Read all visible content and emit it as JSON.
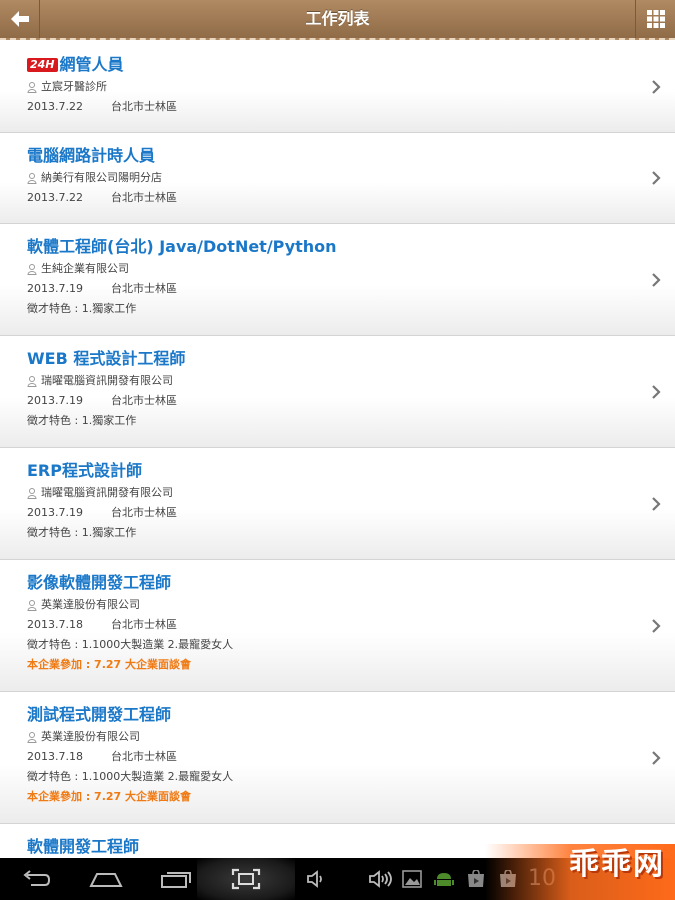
{
  "header": {
    "title": "工作列表"
  },
  "jobs": [
    {
      "badge": "24H",
      "title": "網管人員",
      "company": "立宸牙醫診所",
      "date": "2013.7.22",
      "location": "台北市士林區",
      "feature": "",
      "event": ""
    },
    {
      "badge": "",
      "title": "電腦網路計時人員",
      "company": "納美行有限公司陽明分店",
      "date": "2013.7.22",
      "location": "台北市士林區",
      "feature": "",
      "event": ""
    },
    {
      "badge": "",
      "title": "軟體工程師(台北) Java/DotNet/Python",
      "company": "生純企業有限公司",
      "date": "2013.7.19",
      "location": "台北市士林區",
      "feature": "徵才特色 : 1.獨家工作",
      "event": ""
    },
    {
      "badge": "",
      "title": "WEB 程式設計工程師",
      "company": "瑞曜電腦資訊開發有限公司",
      "date": "2013.7.19",
      "location": "台北市士林區",
      "feature": "徵才特色 : 1.獨家工作",
      "event": ""
    },
    {
      "badge": "",
      "title": "ERP程式設計師",
      "company": "瑞曜電腦資訊開發有限公司",
      "date": "2013.7.19",
      "location": "台北市士林區",
      "feature": "徵才特色 : 1.獨家工作",
      "event": ""
    },
    {
      "badge": "",
      "title": "影像軟體開發工程師",
      "company": "英業達股份有限公司",
      "date": "2013.7.18",
      "location": "台北市士林區",
      "feature": "徵才特色 : 1.1000大製造業 2.最寵愛女人",
      "event": "本企業參加 : 7.27 大企業面談會"
    },
    {
      "badge": "",
      "title": "測試程式開發工程師",
      "company": "英業達股份有限公司",
      "date": "2013.7.18",
      "location": "台北市士林區",
      "feature": "徵才特色 : 1.1000大製造業 2.最寵愛女人",
      "event": "本企業參加 : 7.27 大企業面談會"
    },
    {
      "badge": "",
      "title": "軟體開發工程師",
      "company": "",
      "date": "",
      "location": "",
      "feature": "",
      "event": ""
    }
  ],
  "navbar": {
    "clock": "10",
    "brand": "乖乖网"
  },
  "icons": {
    "back": "arrow-left-icon",
    "grid": "grid-menu-icon",
    "person": "person-icon",
    "chevron": "chevron-right-icon",
    "nav": [
      "back-nav-icon",
      "home-nav-icon",
      "recent-apps-icon",
      "screenshot-icon",
      "volume-down-icon",
      "volume-up-icon",
      "gallery-notification-icon",
      "android-notification-icon",
      "play-store-icon",
      "shop-icon"
    ]
  },
  "colors": {
    "title_blue": "#1b78c8",
    "event_orange": "#f07a14",
    "header_brown": "#9c7752",
    "badge_red": "#d8191d"
  }
}
